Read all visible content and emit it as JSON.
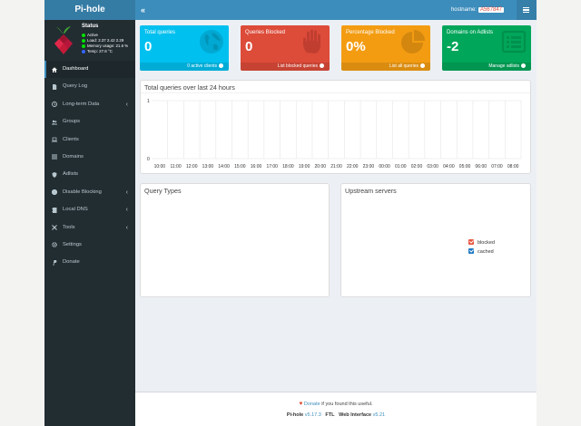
{
  "app": {
    "brand": "Pi-hole"
  },
  "header": {
    "collapse_glyph": "«",
    "hostname_label": "hostname:",
    "hostname_value": "A567847"
  },
  "status": {
    "title": "Status",
    "lines": [
      {
        "text": "Active",
        "color": "#00e000"
      },
      {
        "text": "Load:  2.37  2.42  2.29",
        "color": "#00e000"
      },
      {
        "text": "Memory usage:  21.6 %",
        "color": "#00e000"
      },
      {
        "text": "Temp: 27.8 °C",
        "color": "#3366ff"
      }
    ]
  },
  "nav": {
    "items": [
      {
        "label": "Dashboard",
        "icon": "home-icon",
        "active": true,
        "caret": ""
      },
      {
        "label": "Query Log",
        "icon": "file-icon",
        "active": false,
        "caret": ""
      },
      {
        "label": "Long-term Data",
        "icon": "history-icon",
        "active": false,
        "caret": "‹"
      },
      {
        "label": "Groups",
        "icon": "users-icon",
        "active": false,
        "caret": ""
      },
      {
        "label": "Clients",
        "icon": "laptop-icon",
        "active": false,
        "caret": ""
      },
      {
        "label": "Domains",
        "icon": "list-icon",
        "active": false,
        "caret": ""
      },
      {
        "label": "Adlists",
        "icon": "shield-icon",
        "active": false,
        "caret": ""
      },
      {
        "label": "Disable Blocking",
        "icon": "stop-icon",
        "active": false,
        "caret": "‹"
      },
      {
        "label": "Local DNS",
        "icon": "address-book-icon",
        "active": false,
        "caret": "‹"
      },
      {
        "label": "Tools",
        "icon": "tools-icon",
        "active": false,
        "caret": "‹"
      },
      {
        "label": "Settings",
        "icon": "gear-icon",
        "active": false,
        "caret": ""
      },
      {
        "label": "Donate",
        "icon": "paypal-icon",
        "active": false,
        "caret": ""
      }
    ]
  },
  "stats": [
    {
      "title": "Total queries",
      "value": "0",
      "footer": "0 active clients",
      "color": "#00c0ef",
      "icon": "globe-icon"
    },
    {
      "title": "Queries Blocked",
      "value": "0",
      "footer": "List blocked queries",
      "color": "#dd4b39",
      "icon": "hand-icon"
    },
    {
      "title": "Percentage Blocked",
      "value": "0%",
      "footer": "List all queries",
      "color": "#f39c12",
      "icon": "pie-chart-icon"
    },
    {
      "title": "Domains on Adlists",
      "value": "-2",
      "footer": "Manage adlists",
      "color": "#00a65a",
      "icon": "list-alt-icon"
    }
  ],
  "queries_chart": {
    "title": "Total queries over last 24 hours"
  },
  "chart_data": {
    "type": "bar",
    "title": "Total queries over last 24 hours",
    "categories": [
      "10:00",
      "11:00",
      "12:00",
      "13:00",
      "14:00",
      "15:00",
      "16:00",
      "17:00",
      "18:00",
      "19:00",
      "20:00",
      "21:00",
      "22:00",
      "23:00",
      "00:00",
      "01:00",
      "02:00",
      "03:00",
      "04:00",
      "05:00",
      "06:00",
      "07:00",
      "08:00"
    ],
    "y_ticks": [
      0,
      1
    ],
    "ylim": [
      0,
      1
    ],
    "values": [
      0,
      0,
      0,
      0,
      0,
      0,
      0,
      0,
      0,
      0,
      0,
      0,
      0,
      0,
      0,
      0,
      0,
      0,
      0,
      0,
      0,
      0,
      0
    ],
    "grid": true
  },
  "query_types": {
    "title": "Query Types"
  },
  "upstream": {
    "title": "Upstream servers",
    "legend": [
      {
        "label": "blocked",
        "color": "#e8573f"
      },
      {
        "label": "cached",
        "color": "#1f78c1"
      }
    ]
  },
  "footer": {
    "heart": "♥",
    "donate_link": "Donate",
    "donate_text": "if you found this useful.",
    "pihole_label": "Pi-hole",
    "pihole_version": "v5.17.3",
    "ftl_label": "FTL",
    "web_label": "Web Interface",
    "web_version": "v5.21"
  }
}
